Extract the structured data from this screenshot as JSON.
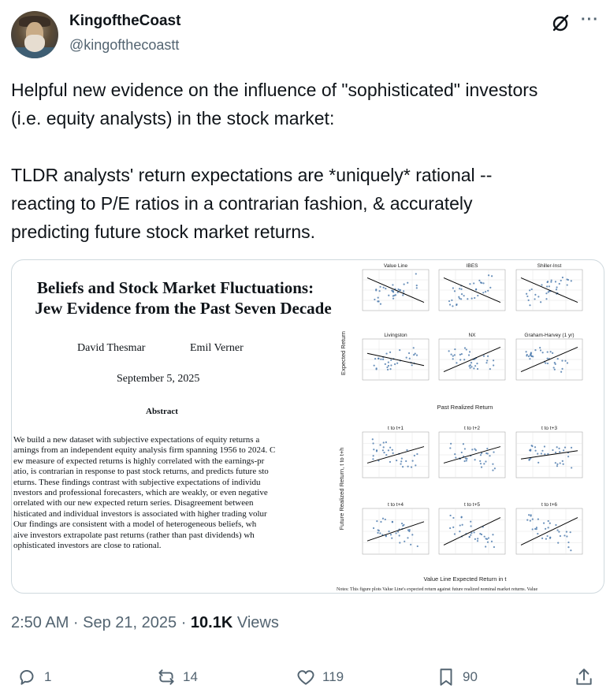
{
  "author": {
    "display_name": "KingoftheCoast",
    "handle": "@kingofthecoastt"
  },
  "tweet": {
    "text": "Helpful new evidence on the influence of \"sophisticated\" investors\n(i.e. equity analysts) in the stock market:\n\nTLDR analysts' return expectations are *uniquely* rational --\nreacting to P/E ratios in a contrarian fashion, & accurately\npredicting future stock market returns.",
    "timestamp": "2:50 AM · Sep 21, 2025 · ",
    "views_count": "10.1K",
    "views_label": " Views"
  },
  "paper": {
    "title_line1": "Beliefs and Stock Market Fluctuations:",
    "title_line2": "Jew Evidence from the Past Seven Decade",
    "author1": "David Thesmar",
    "author2": "Emil Verner",
    "date": "September 5, 2025",
    "abstract_heading": "Abstract",
    "abstract_lines": [
      "We build a new dataset with subjective expectations of equity returns a",
      "arnings from an independent equity analysis firm spanning 1956 to 2024. C",
      "ew measure of expected returns is highly correlated with the earnings-pr",
      "atio, is contrarian in response to past stock returns, and predicts future sto",
      "eturns.  These findings contrast with subjective expectations of individu",
      "nvestors and professional forecasters, which are weakly, or even negative",
      "orrelated with our new expected return series.  Disagreement between",
      "histicated and individual investors is associated with higher trading volur",
      "Our findings are consistent with a model of heterogeneous beliefs, wh",
      "aive investors extrapolate past returns (rather than past dividends) wh",
      "ophisticated investors are close to rational."
    ]
  },
  "figure": {
    "top_panels": [
      "Value Line",
      "IBES",
      "Shiller-Inst",
      "Livingston",
      "NX",
      "Graham-Harvey (1 yr)"
    ],
    "top_ylabel": "Expected Return",
    "top_xlabel": "Past Realized Return",
    "bottom_panels": [
      "t to t+1",
      "t to t+2",
      "t to t+3",
      "t to t+4",
      "t to t+5",
      "t to t+6"
    ],
    "bottom_ylabel": "Future Realized Return, t to t+h",
    "bottom_xlabel": "Value Line Expected Return in t",
    "note": "Notes: This figure plots Value Line's expected return against future realized nominal market returns. Value"
  },
  "actions": {
    "replies": "1",
    "reposts": "14",
    "likes": "119",
    "bookmarks": "90"
  },
  "colors": {
    "text": "#0f1419",
    "muted": "#536471",
    "border": "#cfd9de",
    "scatter": "#3b6ea5"
  }
}
